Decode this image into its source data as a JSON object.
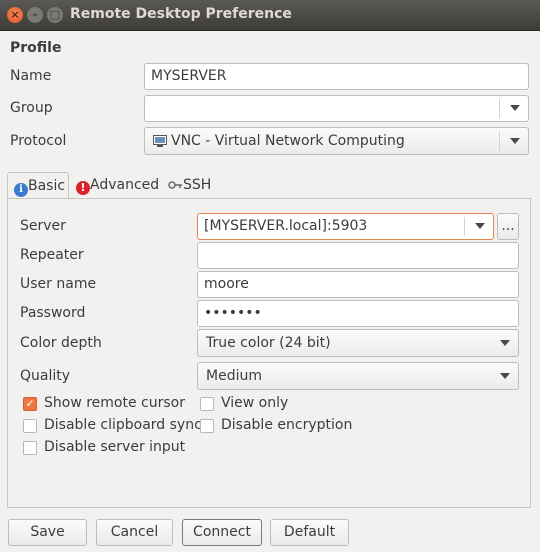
{
  "window": {
    "title": "Remote Desktop Preference",
    "close": "×",
    "minimize": "–",
    "maximize": "□"
  },
  "profile": {
    "heading": "Profile",
    "name_label": "Name",
    "name_value": "MYSERVER",
    "group_label": "Group",
    "group_value": "",
    "protocol_label": "Protocol",
    "protocol_value": "VNC - Virtual Network Computing",
    "protocol_icon": "vnc-protocol-icon"
  },
  "tabs": [
    {
      "label": "Basic",
      "icon": "info-icon",
      "active": true
    },
    {
      "label": "Advanced",
      "icon": "warning-icon",
      "active": false
    },
    {
      "label": "SSH",
      "icon": "key-icon",
      "active": false
    }
  ],
  "basic": {
    "server_label": "Server",
    "server_value": "[MYSERVER.local]:5903",
    "server_browse": "...",
    "repeater_label": "Repeater",
    "repeater_value": "",
    "username_label": "User name",
    "username_value": "moore",
    "password_label": "Password",
    "password_value": "•••••••",
    "colordepth_label": "Color depth",
    "colordepth_value": "True color (24 bit)",
    "quality_label": "Quality",
    "quality_value": "Medium",
    "checkboxes": [
      {
        "label": "Show remote cursor",
        "checked": true
      },
      {
        "label": "View only",
        "checked": false
      },
      {
        "label": "Disable clipboard sync",
        "checked": false
      },
      {
        "label": "Disable encryption",
        "checked": false
      },
      {
        "label": "Disable server input",
        "checked": false
      }
    ]
  },
  "buttons": {
    "save": "Save",
    "cancel": "Cancel",
    "connect": "Connect",
    "default": "Default"
  },
  "colors": {
    "accent": "#f07746",
    "focus_border": "#e2834f",
    "titlebar": "#3d3c38"
  }
}
